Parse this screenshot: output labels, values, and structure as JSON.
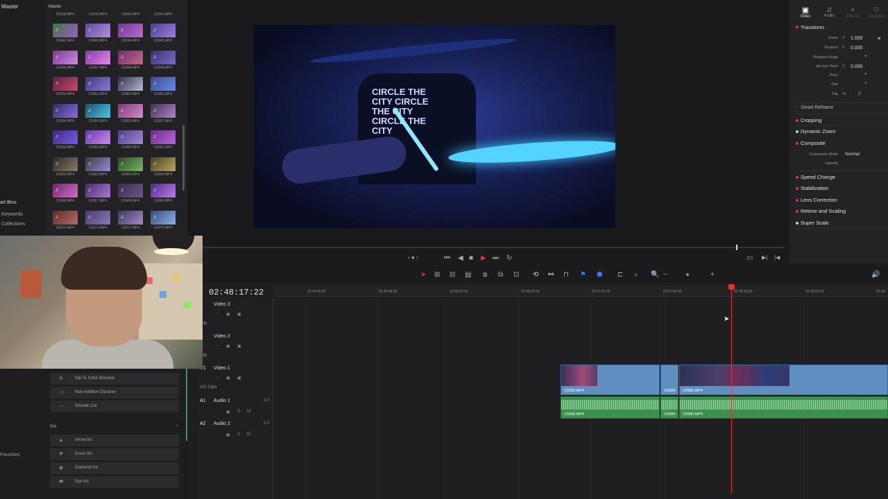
{
  "media_pool": {
    "bin_name": "Master",
    "smart_bins": "art Bins",
    "keywords": "Keywords",
    "collections": "Collections",
    "pool_header": "Master",
    "top_row": [
      "C6938.MP4",
      "C6939.MP4",
      "C6940.MP4",
      "C6941.MP4"
    ],
    "clips": [
      [
        "C6942.MP4",
        "C6943.MP4",
        "C6944.MP4",
        "C6945.MP4"
      ],
      [
        "C6946.MP4",
        "C6947.MP4",
        "C6948.MP4",
        "C6949.MP4"
      ],
      [
        "C6950.MP4",
        "C6951.MP4",
        "C6952.MP4",
        "C6953.MP4"
      ],
      [
        "C6954.MP4",
        "C6955.MP4",
        "C6956.MP4",
        "C6957.MP4"
      ],
      [
        "C6958.MP4",
        "C6959.MP4",
        "C6960.MP4",
        "C6961.MP4"
      ],
      [
        "C6962.MP4",
        "C6963.MP4",
        "C6964.MP4",
        "C6965.MP4"
      ],
      [
        "C6966.MP4",
        "C6967.MP4",
        "C6968.MP4",
        "C6969.MP4"
      ],
      [
        "C6970.MP4",
        "C6971.MP4",
        "C6972.MP4",
        "C6973.MP4"
      ]
    ]
  },
  "viewer": {
    "shirt_print": "CIRCLE THE CITY CIRCLE THE CITY CIRCLE THE CITY"
  },
  "inspector": {
    "tabs": [
      "Video",
      "Audio",
      "Effects",
      "Transition"
    ],
    "transform_label": "Transform",
    "zoom_label": "Zoom",
    "zoom_x": "X",
    "zoom_value": "1.000",
    "position_label": "Position",
    "position_x": "X",
    "position_value": "0.000",
    "rotation_label": "Rotation Angle",
    "anchor_label": "Anchor Point",
    "anchor_x": "X",
    "anchor_value": "0.000",
    "pitch_label": "Pitch",
    "yaw_label": "Yaw",
    "flip_label": "Flip",
    "smart_reframe": "Smart Reframe",
    "cropping": "Cropping",
    "dynamic_zoom": "Dynamic Zoom",
    "composite": "Composite",
    "composite_mode_label": "Composite Mode",
    "composite_mode_value": "Normal",
    "opacity_label": "Opacity",
    "speed_change": "Speed Change",
    "stabilization": "Stabilization",
    "lens_correction": "Lens Correction",
    "retime_scaling": "Retime and Scaling",
    "super_scale": "Super Scale"
  },
  "timeline": {
    "timecode": "02:48:17:22",
    "ruler": [
      "02:44:30:00",
      "02:45:08:00",
      "02:45:46:00",
      "02:46:24:00",
      "02:47:02:00",
      "02:47:40:00",
      "02:48:18:00",
      "02:48:56:00",
      "02:49:"
    ],
    "tracks": {
      "v3_id": "3",
      "v3_name": "Video 3",
      "v3_sub": "Clip",
      "v2_id": "2",
      "v2_name": "Video 2",
      "v2_sub": "Clip",
      "v1_id": "V1",
      "v1_name": "Video 1",
      "v1_sub": "211 Clips",
      "a1_id": "A1",
      "a1_name": "Audio 1",
      "a1_level": "2.0",
      "a2_id": "A2",
      "a2_name": "Audio 2",
      "a2_level": "2.0",
      "s_label": "S",
      "m_label": "M"
    },
    "video_clips": [
      "C6983.MP4",
      "C6984.",
      "C6985.MP4"
    ],
    "audio_clips": [
      "C6983.MP4",
      "C6984.",
      "C6985.MP4"
    ]
  },
  "effects": {
    "items": [
      "Dip To Color Dissolve",
      "Non-Additive Dissolve",
      "Smooth Cut"
    ],
    "iris_header": "Iris",
    "iris_items": [
      "Arrow Iris",
      "Cross Iris",
      "Diamond Iris",
      "Eye Iris"
    ],
    "favorites": "Favorites"
  }
}
